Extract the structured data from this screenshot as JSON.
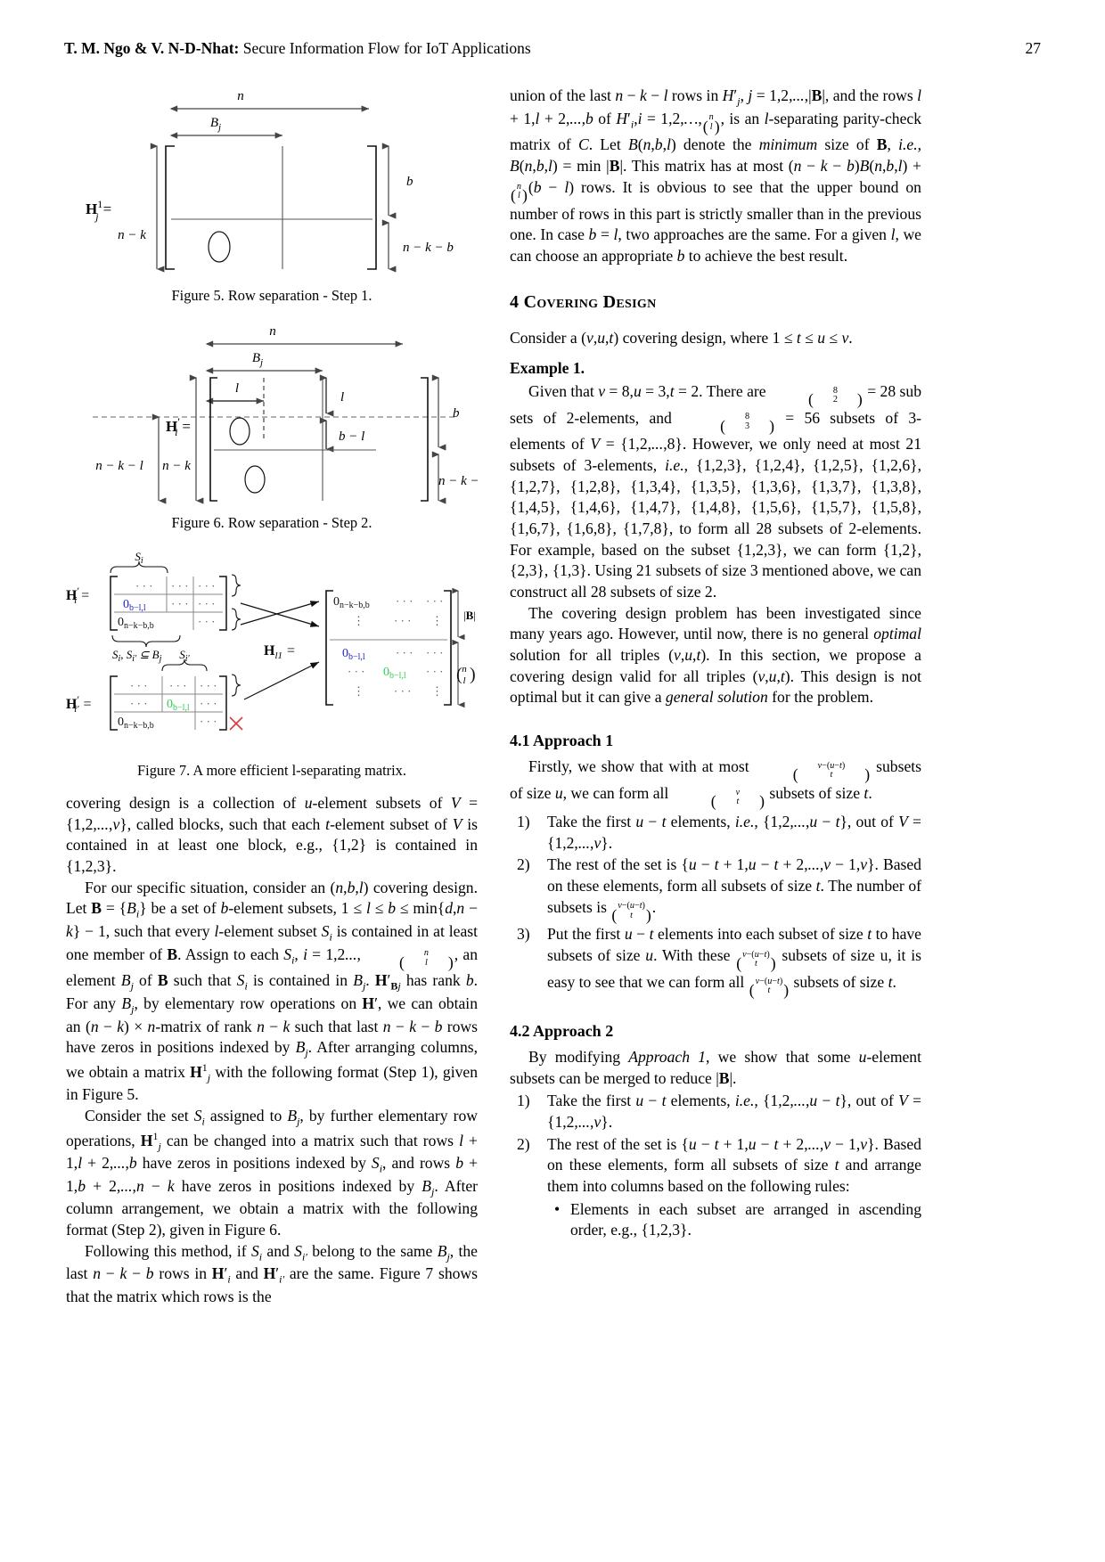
{
  "header": {
    "authors": "T. M. Ngo & V. N-D-Nhat:",
    "title": "Secure Information Flow for IoT Applications",
    "page_number": "27"
  },
  "figures": {
    "fig5": {
      "caption": "Figure 5. Row separation - Step 1.",
      "labels": {
        "n": "n",
        "Bj": "B",
        "Bj_sub": "j",
        "matrix_name": "H",
        "matrix_sup": "1",
        "matrix_sub": "j",
        "eq": "=",
        "left_dim": "n − k",
        "right_top": "b",
        "right_bottom": "n − k − b",
        "zero": "O"
      }
    },
    "fig6": {
      "caption": "Figure 6. Row separation - Step 2.",
      "labels": {
        "n": "n",
        "Bj": "B",
        "Bj_sub": "j",
        "l": "l",
        "matrix_name": "H",
        "matrix_prime": "′",
        "matrix_sub": "i",
        "eq": "=",
        "far_left_dim": "n − k − l",
        "left_dim": "n − k",
        "right_b": "b",
        "right_bml": "b − l",
        "right_bottom": "n − k − b",
        "zero": "O"
      }
    },
    "fig7": {
      "caption": "Figure 7. A more efficient l-separating matrix.",
      "labels": {
        "Si": "S",
        "Si_sub": "i",
        "Sip": "S",
        "Sip_sub": "i′",
        "Hi": "H",
        "Hi_prime": "′",
        "Hi_sub": "i",
        "Hip": "H",
        "Hip_prime": "′",
        "Hip_sub": "i′",
        "Hl1": "H",
        "Hl1_sub": "l1",
        "eq": "=",
        "subset_note": "S",
        "subset_note_sub_a": "i",
        "subset_note_mid": ", S",
        "subset_note_sub_b": "i′",
        "subset_note_tail": " ⊆ B",
        "subset_note_sub_c": "j",
        "zero_bl": "0",
        "zero_bl_sub": "b−l,l",
        "zero_nkb": "0",
        "zero_nkb_sub": "n−k−b,b",
        "dots": "· · ·",
        "vdots": "⋮",
        "B_card": "|B|",
        "binom_top": "n",
        "binom_bottom": "l"
      },
      "colors": {
        "blue": "#2222cc",
        "green": "#33cc55",
        "red": "#e03a3a",
        "gray": "#7a7a7a"
      }
    }
  },
  "left_column": {
    "paragraphs": [
      "covering design is a collection of u-element subsets of V = {1, 2, ..., v}, called blocks, such that each t-element subset of V is contained in at least one block, e.g., {1, 2} is contained in {1, 2, 3}.",
      "For our specific situation, consider an (n, b, l) covering design. Let B = {B_i} be a set of b-element subsets, 1 ≤ l ≤ b ≤ min{d, n − k} − 1, such that every l-element subset S_i is contained in at least one member of B. Assign to each S_i, i = 1, 2..., (n l), an element B_j of B such that S_i is contained in B_j. H′_Bj has rank b. For any B_j, by elementary row operations on H′, we can obtain an (n − k) × n-matrix of rank n − k such that last n − k − b rows have zeros in positions indexed by B_j. After arranging columns, we obtain a matrix H^1_j with the following format (Step 1), given in Figure 5.",
      "Consider the set S_i assigned to B_j, by further elementary row operations, H^1_j can be changed into a matrix such that rows l + 1, l + 2, ..., b have zeros in positions indexed by S_i, and rows b + 1, b + 2, ..., n − k have zeros in positions indexed by B_j. After column arrangement, we obtain a matrix with the following format (Step 2), given in Figure 6.",
      "Following this method, if S_i and S_i′ belong to the same B_j, the last n − k − b rows in H′_i and H′_i′ are the same. Figure 7 shows that the matrix which rows is the"
    ]
  },
  "right_column": {
    "top_paragraph": "union of the last n − k − l rows in H′_j, j = 1, 2, ..., |B|, and the rows l + 1, l + 2, ..., b of H′_i, i = 1, 2, ..., (n l), is an l-separating parity-check matrix of C. Let B(n, b, l) denote the minimum size of B, i.e., B(n, b, l) = min |B|. This matrix has at most (n − k − b)B(n, b, l) + (n l)(b − l) rows. It is obvious to see that the upper bound on number of rows in this part is strictly smaller than in the previous one. In case b = l, two approaches are the same. For a given l, we can choose an appropriate b to achieve the best result.",
    "section": {
      "number": "4",
      "title": "Covering Design",
      "intro": "Consider a (v, u, t) covering design, where 1 ≤ t ≤ u ≤ v.",
      "example_heading": "Example 1.",
      "example_body": "Given that v = 8, u = 3, t = 2. There are (8 2) = 28 subsets of 2-elements, and (8 3) = 56 subsets of 3-elements of V = {1, 2, ..., 8}. However, we only need at most 21 subsets of 3-elements, i.e., {1,2,3}, {1,2,4}, {1,2,5}, {1,2,6}, {1,2,7}, {1,2,8}, {1,3,4}, {1,3,5}, {1,3,6}, {1,3,7}, {1,3,8}, {1,4,5}, {1,4,6}, {1,4,7}, {1,4,8}, {1,5,6}, {1,5,7}, {1,5,8}, {1,6,7}, {1,6,8}, {1,7,8}, to form all 28 subsets of 2-elements. For example, based on the subset {1,2,3}, we can form {1,2}, {2,3}, {1,3}. Using 21 subsets of size 3 mentioned above, we can construct all 28 subsets of size 2.",
      "paragraph_3": "The covering design problem has been investigated since many years ago. However, until now, there is no general optimal solution for all triples (v, u, t). In this section, we propose a covering design valid for all triples (v, u, t). This design is not optimal but it can give a general solution for the problem."
    },
    "subsection_41": {
      "heading": "4.1  Approach 1",
      "intro": "Firstly, we show that with at most (v−(u−t) t) subsets of size u, we can form all (v t) subsets of size t.",
      "items": [
        "Take the first u − t elements, i.e., {1, 2, ..., u − t}, out of V = {1, 2, ..., v}.",
        "The rest of the set is {u − t + 1, u − t + 2, ..., v − 1, v}. Based on these elements, form all subsets of size t. The number of subsets is (v−(u−t) t).",
        "Put the first u − t elements into each subset of size t to have subsets of size u. With these (v−(u−t) t) subsets of size u, it is easy to see that we can form all (v−(u−t) t) subsets of size t."
      ],
      "markers": [
        "1)",
        "2)",
        "3)"
      ]
    },
    "subsection_42": {
      "heading": "4.2  Approach 2",
      "intro": "By modifying Approach 1, we show that some u-element subsets can be merged to reduce |B|.",
      "items": [
        "Take the first u − t elements, i.e., {1, 2, ..., u − t}, out of V = {1, 2, ..., v}.",
        "The rest of the set is {u − t + 1, u − t + 2, ..., v − 1, v}. Based on these elements, form all subsets of size t and arrange them into columns based on the following rules:"
      ],
      "markers": [
        "1)",
        "2)"
      ],
      "bullets": [
        "Elements in each subset are arranged in ascending order, e.g., {1, 2, 3}."
      ],
      "bullet_glyph": "•"
    }
  }
}
